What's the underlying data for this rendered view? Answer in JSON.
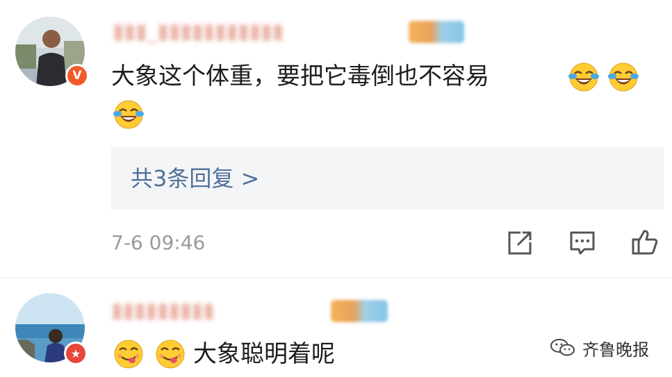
{
  "comments": [
    {
      "text": "大象这个体重，要把它毒倒也不容易",
      "reply_summary": "共3条回复 >",
      "time": "7-6 09:46",
      "badge_label": "V"
    },
    {
      "text": "大象聪明着呢",
      "badge_label": "★"
    }
  ],
  "icons": {
    "laugh_cry": "face-with-tears-of-joy-icon",
    "yum": "savoring-food-face-icon",
    "share": "share-icon",
    "reply": "comment-icon",
    "like": "thumbs-up-icon"
  },
  "watermark": {
    "text": "齐鲁晚报",
    "icon": "wechat-icon"
  },
  "colors": {
    "reply_link": "#50709a",
    "badge_v": "#f25a2a",
    "badge_star": "#e8463a"
  }
}
